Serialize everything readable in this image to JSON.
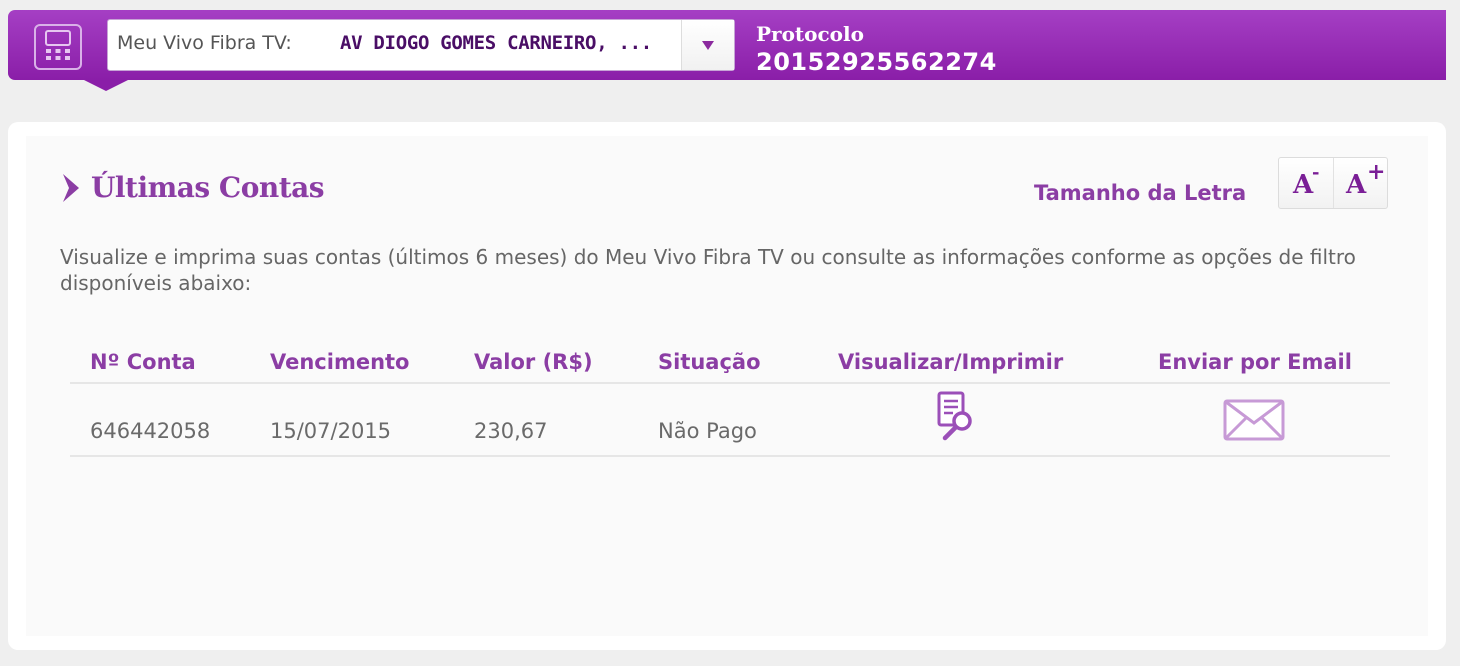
{
  "header": {
    "account_selector": {
      "prefix": "Meu Vivo Fibra TV:",
      "selected_value": "AV DIOGO GOMES CARNEIRO, ..."
    },
    "protocol": {
      "label": "Protocolo",
      "value": "20152925562274"
    },
    "icons": {
      "device": "phone-device-icon",
      "dropdown": "chevron-down-icon"
    }
  },
  "section": {
    "title": "Últimas Contas",
    "font_size": {
      "label": "Tamanho da Letra",
      "decrease": {
        "letter": "A",
        "sign": "-"
      },
      "increase": {
        "letter": "A",
        "sign": "+"
      }
    },
    "description": "Visualize e imprima suas contas (últimos 6 meses) do Meu Vivo Fibra TV ou consulte as informações conforme as opções de filtro disponíveis abaixo:"
  },
  "table": {
    "headers": [
      "Nº Conta",
      "Vencimento",
      "Valor (R$)",
      "Situação",
      "Visualizar/Imprimir",
      "Enviar por Email"
    ],
    "rows": [
      {
        "account_number": "646442058",
        "due_date": "15/07/2015",
        "amount": "230,67",
        "status": "Não Pago",
        "view_icon": "document-magnifier-icon",
        "email_icon": "envelope-icon"
      }
    ]
  },
  "colors": {
    "brand_purple": "#8a1ea8",
    "accent_purple": "#8b3da4",
    "background": "#efefef"
  }
}
